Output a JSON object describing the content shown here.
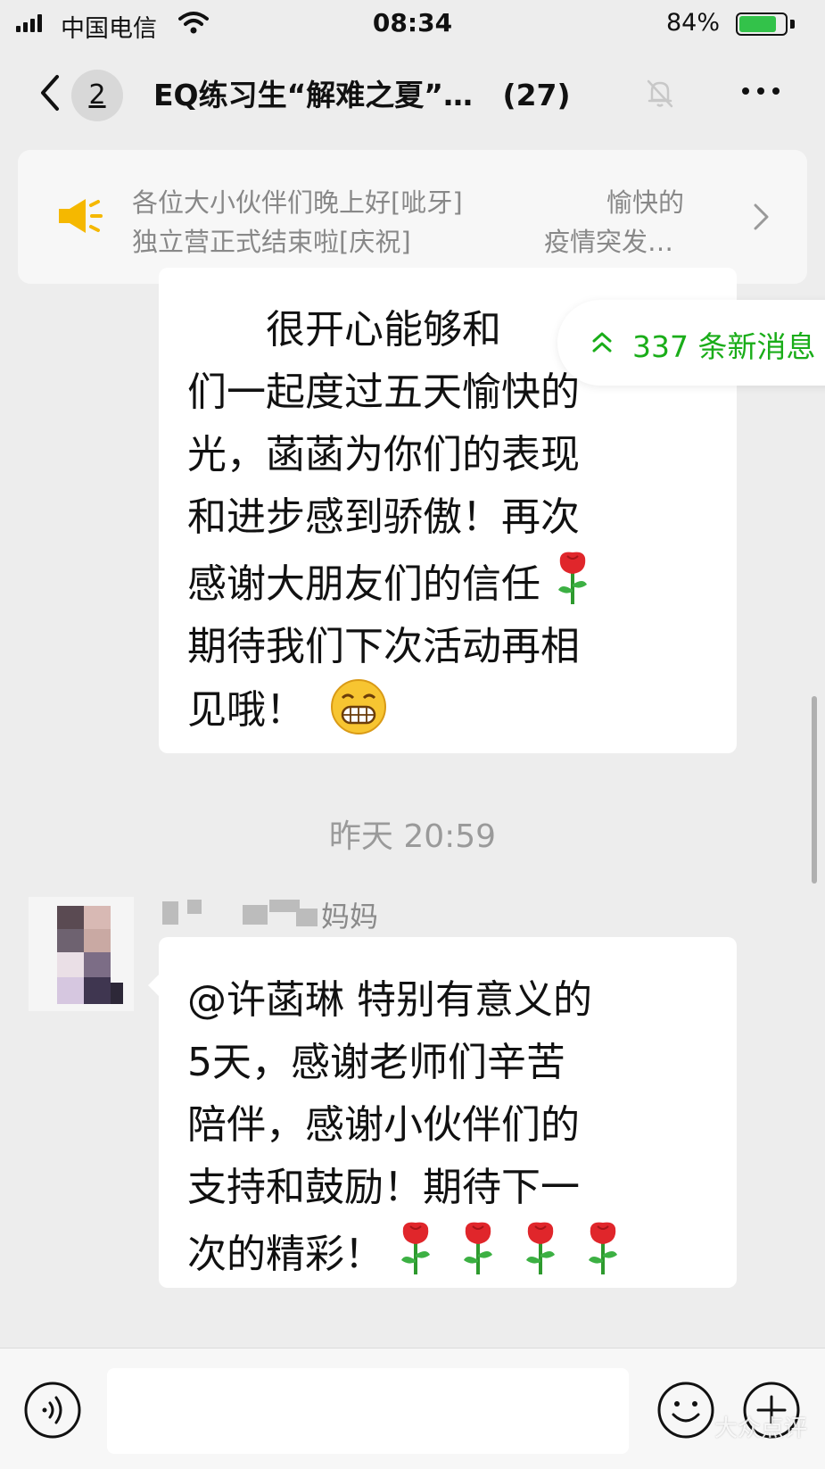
{
  "status_bar": {
    "carrier": "中国电信",
    "time": "08:34",
    "battery_percent": "84%"
  },
  "nav": {
    "back_icon": "chevron-left-icon",
    "unread_count": "2",
    "title": "EQ练习生“解难之夏”…",
    "member_count": "(27)",
    "mute_icon": "bell-slash-icon",
    "more_icon": "ellipsis-icon"
  },
  "announcement": {
    "icon": "speaker-icon",
    "line1a": "各位大小伙伴们晚上好[呲牙]",
    "line1b": "愉快的",
    "line2a": "独立营正式结束啦[庆祝]",
    "line2b": "疫情突发…",
    "chevron_icon": "chevron-right-icon"
  },
  "new_messages": {
    "icon": "double-chevron-up-icon",
    "label": "337 条新消息",
    "color": "#1aad19"
  },
  "messages": [
    {
      "lines": [
        "　　很开心能够和",
        "们一起度过五天愉快的",
        "光，菡菡为你们的表现",
        "和进步感到骄傲！再次",
        "感谢大朋友们的信任",
        "期待我们下次活动再相",
        "见哦！"
      ]
    },
    {
      "sender_suffix": "妈妈",
      "lines": [
        "@许菡琳 特别有意义的",
        "5天，感谢老师们辛苦",
        "陪伴，感谢小伙伴们的",
        "支持和鼓励！期待下一",
        "次的精彩！"
      ]
    }
  ],
  "timestamp": "昨天 20:59",
  "input_bar": {
    "voice_icon": "voice-icon",
    "emoji_icon": "smiley-icon",
    "plus_icon": "plus-circle-icon"
  },
  "watermark": "大众点评"
}
